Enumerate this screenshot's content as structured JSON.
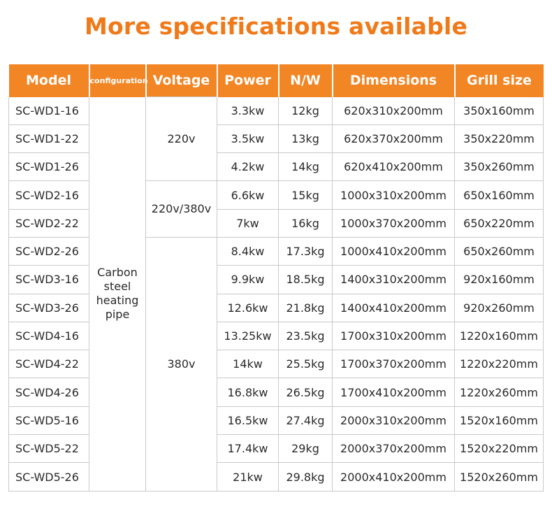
{
  "title": "More specifications available",
  "headers": [
    "Model",
    "configuration",
    "Voltage",
    "Power",
    "N/W",
    "Dimensions",
    "Grill size"
  ],
  "configuration": "Carbon steel heating pipe",
  "voltages": [
    "220v",
    "220v/380v",
    "380v"
  ],
  "rows": [
    {
      "model": "SC-WD1-16",
      "power": "3.3kw",
      "nw": "12kg",
      "dimensions": "620x310x200mm",
      "grill": "350x160mm"
    },
    {
      "model": "SC-WD1-22",
      "power": "3.5kw",
      "nw": "13kg",
      "dimensions": "620x370x200mm",
      "grill": "350x220mm"
    },
    {
      "model": "SC-WD1-26",
      "power": "4.2kw",
      "nw": "14kg",
      "dimensions": "620x410x200mm",
      "grill": "350x260mm"
    },
    {
      "model": "SC-WD2-16",
      "power": "6.6kw",
      "nw": "15kg",
      "dimensions": "1000x310x200mm",
      "grill": "650x160mm"
    },
    {
      "model": "SC-WD2-22",
      "power": "7kw",
      "nw": "16kg",
      "dimensions": "1000x370x200mm",
      "grill": "650x220mm"
    },
    {
      "model": "SC-WD2-26",
      "power": "8.4kw",
      "nw": "17.3kg",
      "dimensions": "1000x410x200mm",
      "grill": "650x260mm"
    },
    {
      "model": "SC-WD3-16",
      "power": "9.9kw",
      "nw": "18.5kg",
      "dimensions": "1400x310x200mm",
      "grill": "920x160mm"
    },
    {
      "model": "SC-WD3-26",
      "power": "12.6kw",
      "nw": "21.8kg",
      "dimensions": "1400x410x200mm",
      "grill": "920x260mm"
    },
    {
      "model": "SC-WD4-16",
      "power": "13.25kw",
      "nw": "23.5kg",
      "dimensions": "1700x310x200mm",
      "grill": "1220x160mm"
    },
    {
      "model": "SC-WD4-22",
      "power": "14kw",
      "nw": "25.5kg",
      "dimensions": "1700x370x200mm",
      "grill": "1220x220mm"
    },
    {
      "model": "SC-WD4-26",
      "power": "16.8kw",
      "nw": "26.5kg",
      "dimensions": "1700x410x200mm",
      "grill": "1220x260mm"
    },
    {
      "model": "SC-WD5-16",
      "power": "16.5kw",
      "nw": "27.4kg",
      "dimensions": "2000x310x200mm",
      "grill": "1520x160mm"
    },
    {
      "model": "SC-WD5-22",
      "power": "17.4kw",
      "nw": "29kg",
      "dimensions": "2000x370x200mm",
      "grill": "1520x220mm"
    },
    {
      "model": "SC-WD5-26",
      "power": "21kw",
      "nw": "29.8kg",
      "dimensions": "2000x410x200mm",
      "grill": "1520x260mm"
    }
  ],
  "colors": {
    "accent": "#f28524",
    "title": "#f07a1a",
    "border": "#c9c9c9"
  }
}
